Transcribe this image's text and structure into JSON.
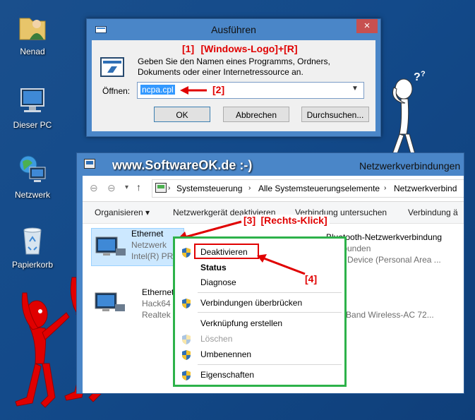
{
  "desktop": {
    "icons": [
      {
        "label": "Nenad",
        "icon": "user-folder-icon"
      },
      {
        "label": "Dieser PC",
        "icon": "computer-icon"
      },
      {
        "label": "Netzwerk",
        "icon": "network-icon"
      },
      {
        "label": "Papierkorb",
        "icon": "recycle-bin-icon"
      }
    ]
  },
  "run_dialog": {
    "title": "Ausführen",
    "description": "Geben Sie den Namen eines Programms, Ordners, Dokuments oder einer Internetressource an.",
    "open_label": "Öffnen:",
    "open_value": "ncpa.cpl",
    "ok": "OK",
    "cancel": "Abbrechen",
    "browse": "Durchsuchen...",
    "close": "×"
  },
  "annotations": {
    "a1_num": "[1]",
    "a1_text": "[Windows-Logo]+[R]",
    "a2": "[2]",
    "a3_num": "[3]",
    "a3_text": "[Rechts-Klick]",
    "a4": "[4]",
    "watermark": "www.SoftwareOK.de :-)"
  },
  "explorer": {
    "title": "Netzwerkverbindungen",
    "breadcrumb": [
      "Systemsteuerung",
      "Alle Systemsteuerungselemente",
      "Netzwerkverbind"
    ],
    "commands": [
      "Organisieren ▾",
      "Netzwerkgerät deaktivieren",
      "Verbindung untersuchen",
      "Verbindung ä"
    ],
    "items": [
      {
        "name": "Ethernet",
        "status": "Netzwerk",
        "device": "Intel(R) PRO"
      },
      {
        "name": "Ethernet",
        "status": "Hack64",
        "device": "Realtek PC"
      },
      {
        "name": "Bluetooth-Netzwerkverbindung",
        "status": "t verbunden",
        "device": "tooth Device (Personal Area ..."
      },
      {
        "name": "",
        "status": "iert",
        "device": "Dual Band Wireless-AC 72..."
      }
    ]
  },
  "context_menu": {
    "items": [
      {
        "label": "Deaktivieren",
        "shield": true
      },
      {
        "label": "Status",
        "bold": true
      },
      {
        "label": "Diagnose"
      },
      {
        "label": "Verbindungen überbrücken",
        "shield": true
      },
      {
        "label": "Verknüpfung erstellen"
      },
      {
        "label": "Löschen",
        "disabled": true,
        "shield": true
      },
      {
        "label": "Umbenennen",
        "shield": true
      },
      {
        "label": "Eigenschaften",
        "shield": true
      }
    ]
  },
  "colors": {
    "accent_red": "#e00000",
    "menu_border": "#2db24a",
    "desktop": "#1a4f8c",
    "titlebar": "#4a86c8"
  }
}
